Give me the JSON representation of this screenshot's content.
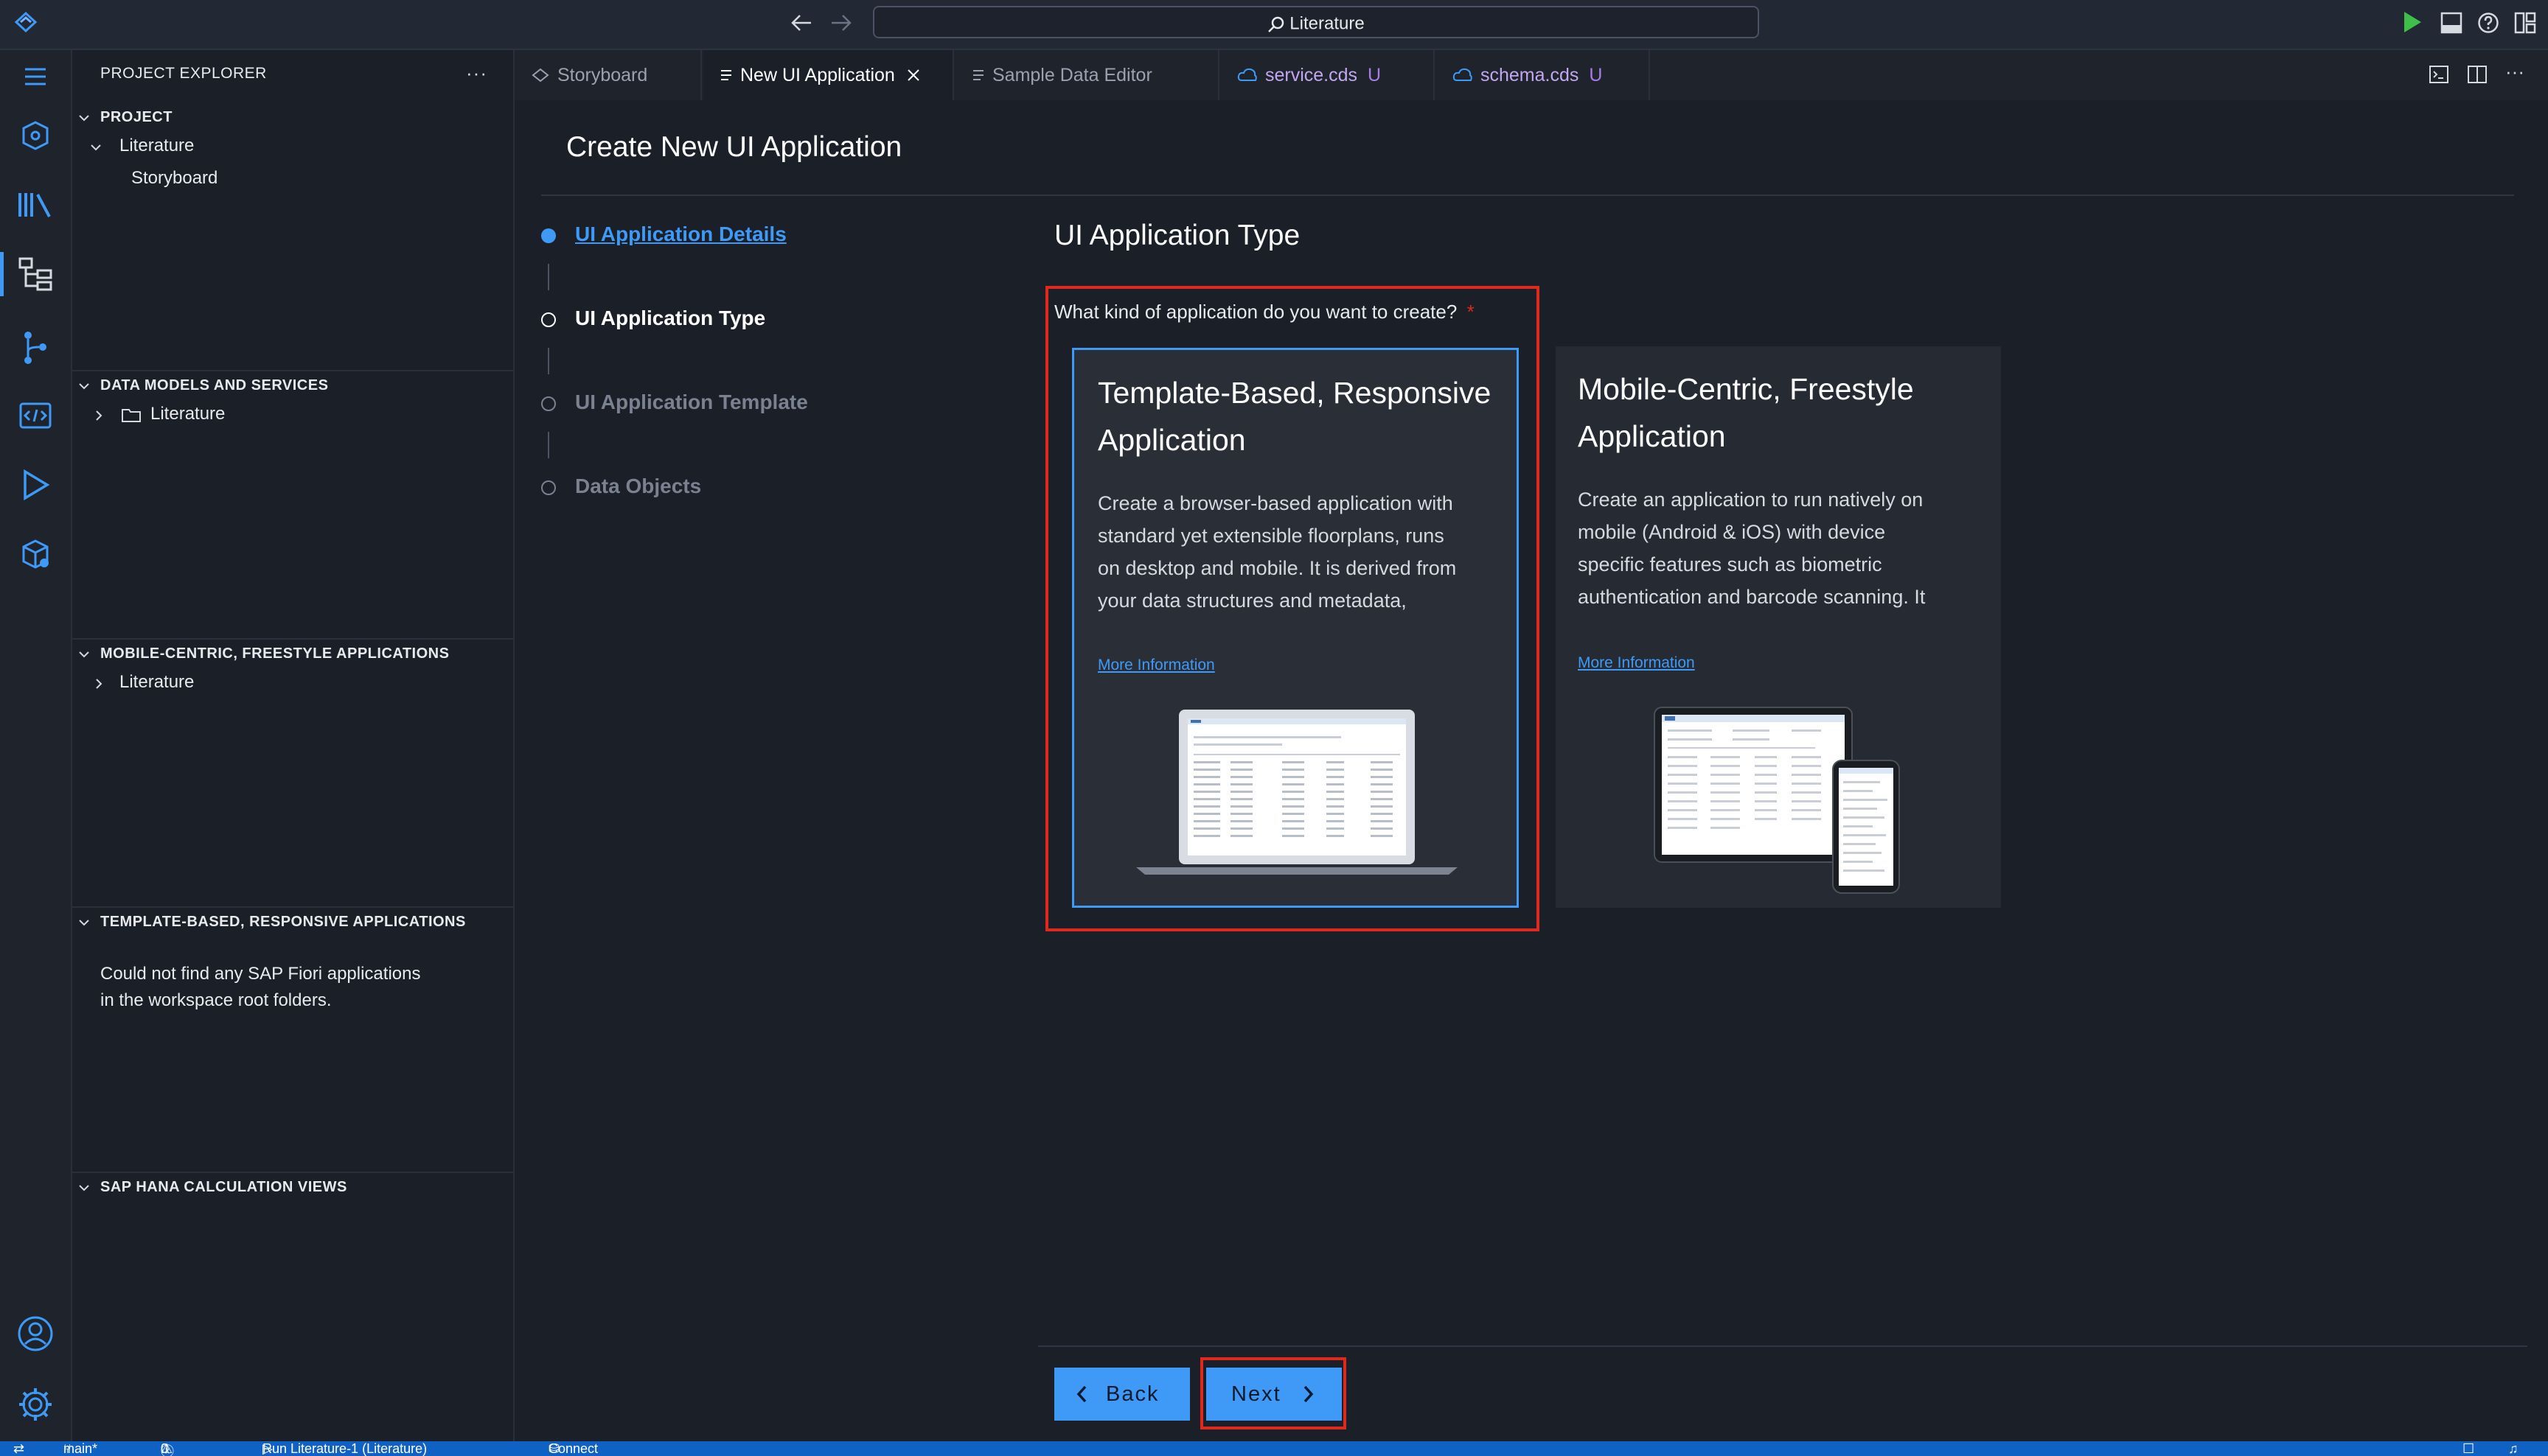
{
  "title_bar": {
    "command_center": "Literature"
  },
  "activity_bar": {
    "items": [
      "menu-icon",
      "storyboard-icon",
      "library-icon",
      "explorer-icon",
      "source-control-icon",
      "code-icon",
      "run-icon",
      "extensions-icon"
    ],
    "bottom": [
      "account-icon",
      "settings-icon"
    ]
  },
  "sidebar": {
    "title": "PROJECT EXPLORER",
    "sections": [
      {
        "label": "PROJECT",
        "items": [
          {
            "label": "Literature"
          },
          {
            "label": "Storyboard"
          }
        ]
      },
      {
        "label": "DATA MODELS AND SERVICES",
        "items": [
          {
            "label": "Literature"
          }
        ]
      },
      {
        "label": "MOBILE-CENTRIC, FREESTYLE APPLICATIONS",
        "items": [
          {
            "label": "Literature"
          }
        ]
      },
      {
        "label": "TEMPLATE-BASED, RESPONSIVE APPLICATIONS",
        "message_line1": "Could not find any SAP Fiori applications",
        "message_line2": "in the workspace root folders."
      },
      {
        "label": "SAP HANA CALCULATION VIEWS"
      }
    ]
  },
  "tabs": [
    {
      "label": "Storyboard"
    },
    {
      "label": "New UI Application"
    },
    {
      "label": "Sample Data Editor"
    },
    {
      "label": "service.cds",
      "badge": "U"
    },
    {
      "label": "schema.cds",
      "badge": "U"
    }
  ],
  "page": {
    "title": "Create New UI Application",
    "steps": [
      {
        "label": "UI Application Details"
      },
      {
        "label": "UI Application Type"
      },
      {
        "label": "UI Application Template"
      },
      {
        "label": "Data Objects"
      }
    ],
    "section_title": "UI Application Type",
    "question": "What kind of application do you want to create?",
    "required_mark": "*",
    "cards": [
      {
        "title_line1": "Template-Based, Responsive",
        "title_line2": "Application",
        "desc": [
          "Create a browser-based application with",
          "standard yet extensible floorplans, runs",
          "on desktop and mobile. It is derived from",
          "your data structures and metadata,"
        ],
        "link": "More Information",
        "selected": true
      },
      {
        "title_line1": "Mobile-Centric, Freestyle",
        "title_line2": "Application",
        "desc": [
          "Create an application to run natively on",
          "mobile (Android & iOS) with device",
          "specific features such as biometric",
          "authentication and barcode scanning. It"
        ],
        "link": "More Information",
        "selected": false
      }
    ],
    "back_label": "Back",
    "next_label": "Next"
  },
  "status_bar": {
    "branch": "main*",
    "errors": "0",
    "warnings": "0",
    "run": "Run Literature-1 (Literature)",
    "connect": "Connect"
  },
  "colors": {
    "accent": "#3f9af7",
    "highlight": "#e0281c",
    "background": "#1b1f27",
    "card": "#262b33",
    "statusbar": "#0f62c4"
  }
}
